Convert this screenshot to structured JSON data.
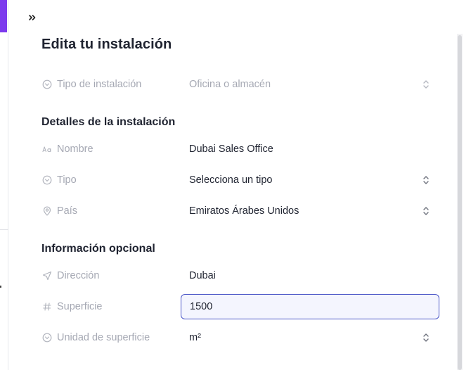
{
  "panel": {
    "title": "Edita tu instalación",
    "facility_type": {
      "label": "Tipo de instalación",
      "value": "Oficina o almacén",
      "icon": "circle-chevron-icon"
    },
    "details_section": {
      "title": "Detalles de la instalación",
      "name": {
        "label": "Nombre",
        "value": "Dubai Sales Office",
        "icon": "text-aa-icon"
      },
      "type": {
        "label": "Tipo",
        "placeholder": "Selecciona un tipo",
        "icon": "circle-chevron-icon"
      },
      "country": {
        "label": "País",
        "value": "Emiratos Árabes Unidos",
        "icon": "location-pin-icon"
      }
    },
    "optional_section": {
      "title": "Información opcional",
      "address": {
        "label": "Dirección",
        "value": "Dubai",
        "icon": "navigation-arrow-icon"
      },
      "area": {
        "label": "Superficie",
        "value": "1500",
        "icon": "hash-icon"
      },
      "area_unit": {
        "label": "Unidad de superficie",
        "value": "m²",
        "icon": "circle-chevron-icon"
      }
    }
  },
  "colors": {
    "accent": "#7c3aed",
    "focus_border": "#4a55c7",
    "label_gray": "#a5a8b3",
    "text_dark": "#1f2330"
  }
}
